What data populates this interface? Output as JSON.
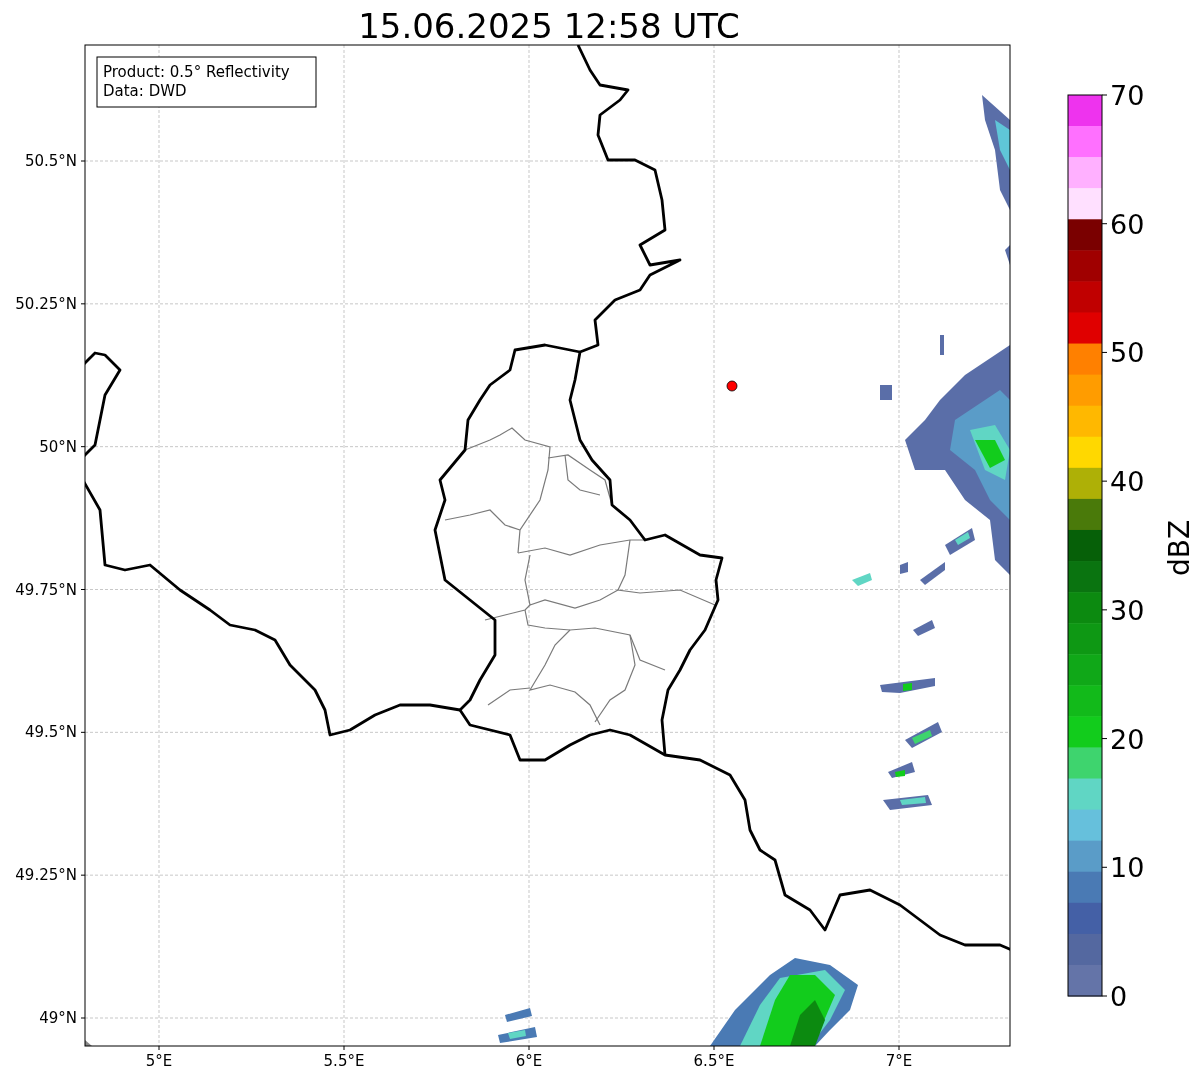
{
  "title": "15.06.2025 12:58 UTC",
  "legend": {
    "lines": [
      "Product: 0.5° Reflectivity",
      "Data: DWD"
    ]
  },
  "map": {
    "lat_labels": [
      "50.5°N",
      "50.25°N",
      "50°N",
      "49.75°N",
      "49.5°N",
      "49.25°N",
      "49°N"
    ],
    "lon_labels": [
      "5°E",
      "5.5°E",
      "6°E",
      "6.5°E",
      "7°E"
    ]
  },
  "colorbar": {
    "label": "dBZ",
    "ticks": [
      "70",
      "60",
      "50",
      "40",
      "30",
      "20",
      "10",
      "0"
    ],
    "bands": [
      {
        "color": "#ee33ee"
      },
      {
        "color": "#ff70ff"
      },
      {
        "color": "#ffb0ff"
      },
      {
        "color": "#ffe0ff"
      },
      {
        "color": "#7a0000"
      },
      {
        "color": "#a00000"
      },
      {
        "color": "#c00000"
      },
      {
        "color": "#e00000"
      },
      {
        "color": "#ff8000"
      },
      {
        "color": "#ff9c00"
      },
      {
        "color": "#ffb800"
      },
      {
        "color": "#ffd800"
      },
      {
        "color": "#aeb006"
      },
      {
        "color": "#4a7a0a"
      },
      {
        "color": "#066008"
      },
      {
        "color": "#0a7410"
      },
      {
        "color": "#0c8a10"
      },
      {
        "color": "#0e9814"
      },
      {
        "color": "#10a818"
      },
      {
        "color": "#12ba1a"
      },
      {
        "color": "#12cc1c"
      },
      {
        "color": "#3ed46e"
      },
      {
        "color": "#60d6c4"
      },
      {
        "color": "#66c0dc"
      },
      {
        "color": "#5a9cc8"
      },
      {
        "color": "#4a7ab4"
      },
      {
        "color": "#4460a6"
      },
      {
        "color": "#5468a0"
      },
      {
        "color": "#6474a8"
      }
    ]
  }
}
